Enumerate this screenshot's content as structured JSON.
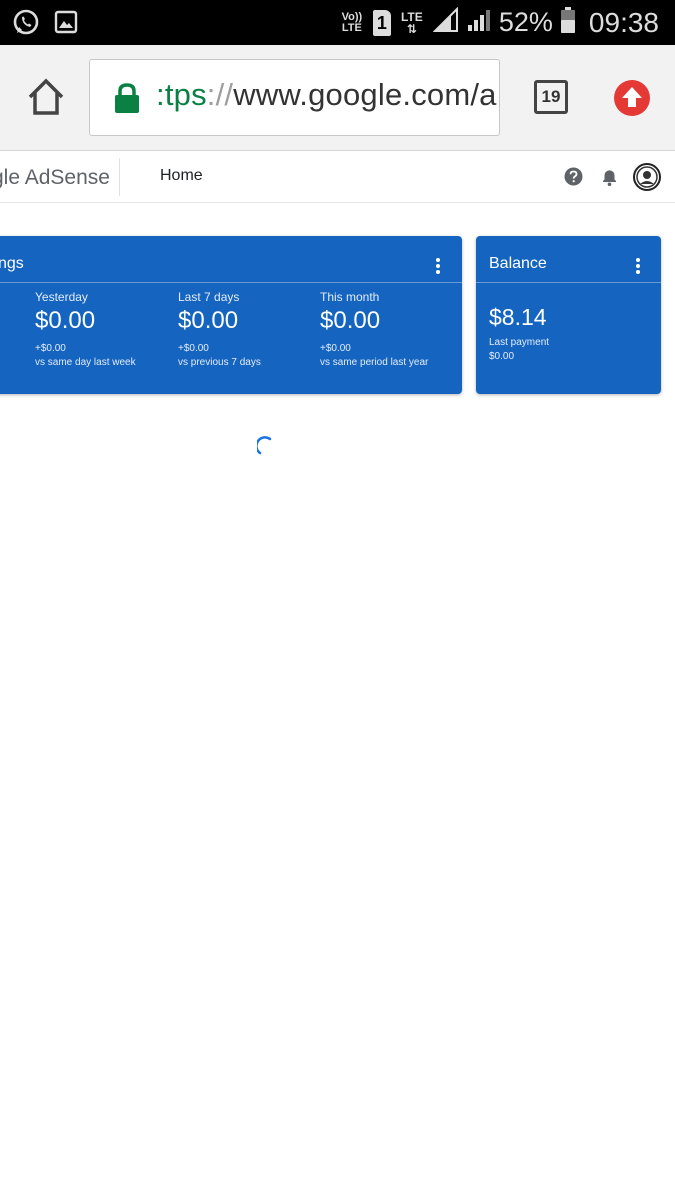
{
  "status_bar": {
    "volte_label": "Vo)) LTE",
    "sim_slot": "1",
    "lte_label": "LTE",
    "battery_percent": "52%",
    "time": "09:38"
  },
  "browser": {
    "url_scheme_tail": ":tps",
    "url_sep": "://",
    "url_host": "www.google.com/a",
    "tab_count": "19"
  },
  "app_header": {
    "logo": "gle AdSense",
    "nav_home": "Home"
  },
  "earnings_card": {
    "title": "ngs",
    "metrics": [
      {
        "label": "Yesterday",
        "value": "$0.00",
        "delta": "+$0.00",
        "compare": "vs same day last week"
      },
      {
        "label": "Last 7 days",
        "value": "$0.00",
        "delta": "+$0.00",
        "compare": "vs previous 7 days"
      },
      {
        "label": "This month",
        "value": "$0.00",
        "delta": "+$0.00",
        "compare": "vs same period last year"
      }
    ]
  },
  "balance_card": {
    "title": "Balance",
    "value": "$8.14",
    "last_payment_label": "Last payment",
    "last_payment_value": "$0.00"
  },
  "colors": {
    "card_blue": "#1565c0",
    "secure_green": "#0b8043",
    "upload_red": "#e53935"
  }
}
